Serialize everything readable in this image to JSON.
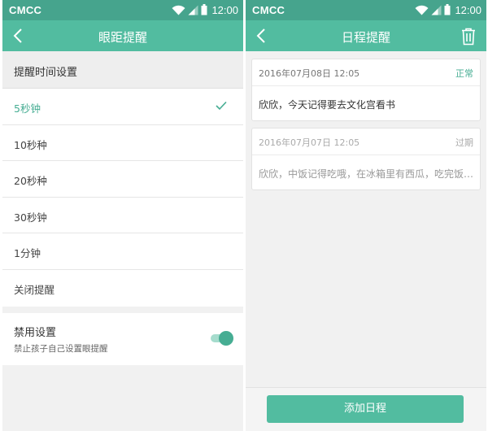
{
  "status_bar": {
    "carrier": "CMCC",
    "time": "12:00"
  },
  "theme": {
    "primary": "#52bca0",
    "status_bar": "#46a48d",
    "accent_text": "#46ad93",
    "background": "#f1f1f1"
  },
  "eye_screen": {
    "title": "眼距提醒",
    "back_icon": "chevron-left-icon",
    "section_header": "提醒时间设置",
    "options": [
      {
        "label": "5秒钟",
        "selected": true
      },
      {
        "label": "10秒种",
        "selected": false
      },
      {
        "label": "20秒种",
        "selected": false
      },
      {
        "label": "30秒钟",
        "selected": false
      },
      {
        "label": "1分钟",
        "selected": false
      },
      {
        "label": "关闭提醒",
        "selected": false
      }
    ],
    "selected_icon": "check-icon",
    "disable": {
      "title": "禁用设置",
      "description": "禁止孩子自己设置眼提醒",
      "toggle_on": true
    }
  },
  "schedule_screen": {
    "title": "日程提醒",
    "back_icon": "chevron-left-icon",
    "delete_icon": "trash-icon",
    "reminders": [
      {
        "datetime": "2016年07月08日 12:05",
        "status": "正常",
        "status_color": "#46ad93",
        "message": "欣欣，今天记得要去文化宫看书"
      },
      {
        "datetime": "2016年07月07日 12:05",
        "status": "过期",
        "status_color": "#aaaaaa",
        "message": "欣欣，中饭记得吃哦，在冰箱里有西瓜，吃完饭再吃哦"
      }
    ],
    "add_button": "添加日程"
  }
}
